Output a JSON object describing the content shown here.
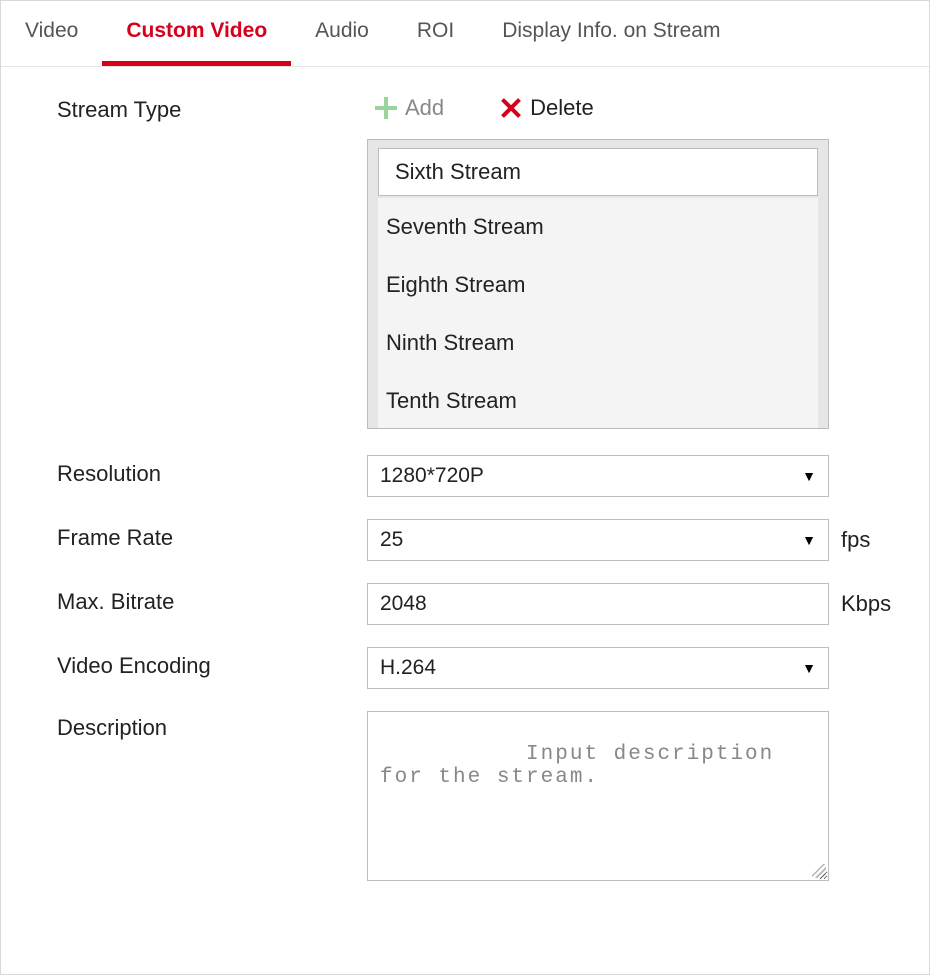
{
  "tabs": {
    "video": "Video",
    "custom_video": "Custom Video",
    "audio": "Audio",
    "roi": "ROI",
    "display_info": "Display Info. on Stream"
  },
  "labels": {
    "stream_type": "Stream Type",
    "resolution": "Resolution",
    "frame_rate": "Frame Rate",
    "max_bitrate": "Max. Bitrate",
    "video_encoding": "Video Encoding",
    "description": "Description"
  },
  "actions": {
    "add": "Add",
    "delete": "Delete"
  },
  "stream_list": {
    "selected": "Sixth Stream",
    "items": [
      "Seventh Stream",
      "Eighth Stream",
      "Ninth Stream",
      "Tenth Stream"
    ]
  },
  "values": {
    "resolution": "1280*720P",
    "frame_rate": "25",
    "frame_rate_unit": "fps",
    "max_bitrate": "2048",
    "max_bitrate_unit": "Kbps",
    "video_encoding": "H.264",
    "description_placeholder": "Input description for the stream."
  }
}
